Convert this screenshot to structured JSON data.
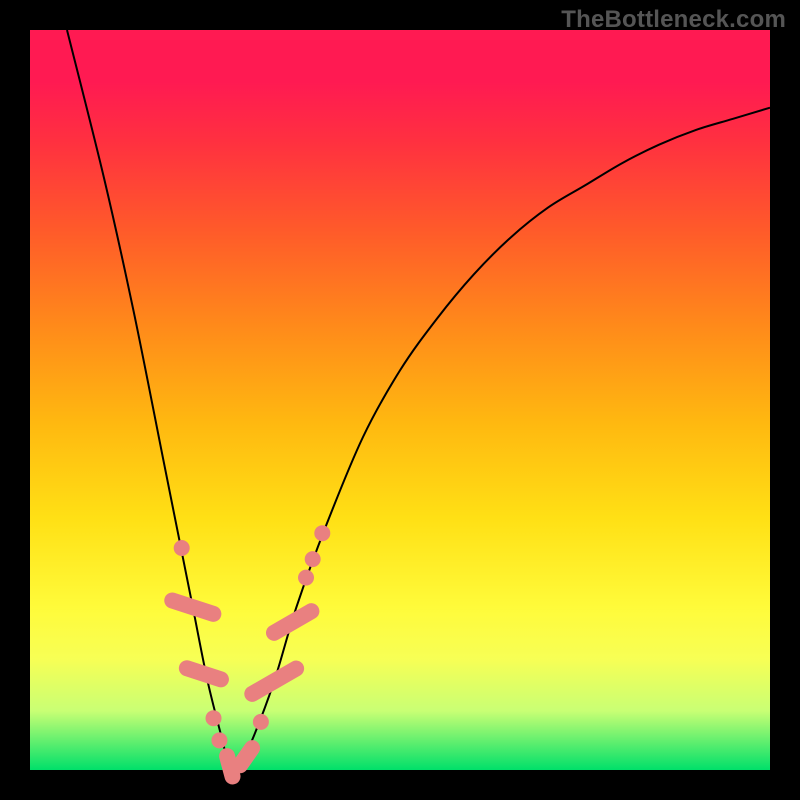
{
  "watermark": "TheBottleneck.com",
  "colors": {
    "background": "#000000",
    "gradient_top": "#ff1a52",
    "gradient_bottom": "#00e06a",
    "curve": "#000000",
    "markers": "#e98080"
  },
  "chart_data": {
    "type": "line",
    "title": "",
    "xlabel": "",
    "ylabel": "",
    "xlim": [
      0,
      100
    ],
    "ylim": [
      0,
      100
    ],
    "series": [
      {
        "name": "bottleneck-curve",
        "x": [
          5,
          10,
          14,
          18,
          20,
          22,
          24,
          26,
          27,
          28,
          30,
          33,
          36,
          40,
          45,
          50,
          55,
          60,
          65,
          70,
          75,
          80,
          85,
          90,
          95,
          100
        ],
        "values": [
          100,
          80,
          62,
          42,
          32,
          22,
          12,
          4,
          0,
          0,
          4,
          12,
          22,
          33,
          45,
          54,
          61,
          67,
          72,
          76,
          79,
          82,
          84.5,
          86.5,
          88,
          89.5
        ]
      }
    ],
    "markers": [
      {
        "shape": "dot",
        "cx": 20.5,
        "cy": 30
      },
      {
        "shape": "pill",
        "cx": 22.0,
        "cy": 22,
        "len": 8,
        "angle": -72
      },
      {
        "shape": "pill",
        "cx": 23.5,
        "cy": 13,
        "len": 7,
        "angle": -72
      },
      {
        "shape": "dot",
        "cx": 24.8,
        "cy": 7
      },
      {
        "shape": "dot",
        "cx": 25.6,
        "cy": 4
      },
      {
        "shape": "pill",
        "cx": 27.0,
        "cy": 0.5,
        "len": 5,
        "angle": -15
      },
      {
        "shape": "pill",
        "cx": 29.2,
        "cy": 1.8,
        "len": 5,
        "angle": 35
      },
      {
        "shape": "dot",
        "cx": 31.2,
        "cy": 6.5
      },
      {
        "shape": "pill",
        "cx": 33.0,
        "cy": 12,
        "len": 9,
        "angle": 60
      },
      {
        "shape": "pill",
        "cx": 35.5,
        "cy": 20,
        "len": 8,
        "angle": 60
      },
      {
        "shape": "dot",
        "cx": 37.3,
        "cy": 26
      },
      {
        "shape": "dot",
        "cx": 38.2,
        "cy": 28.5
      },
      {
        "shape": "dot",
        "cx": 39.5,
        "cy": 32
      }
    ]
  }
}
